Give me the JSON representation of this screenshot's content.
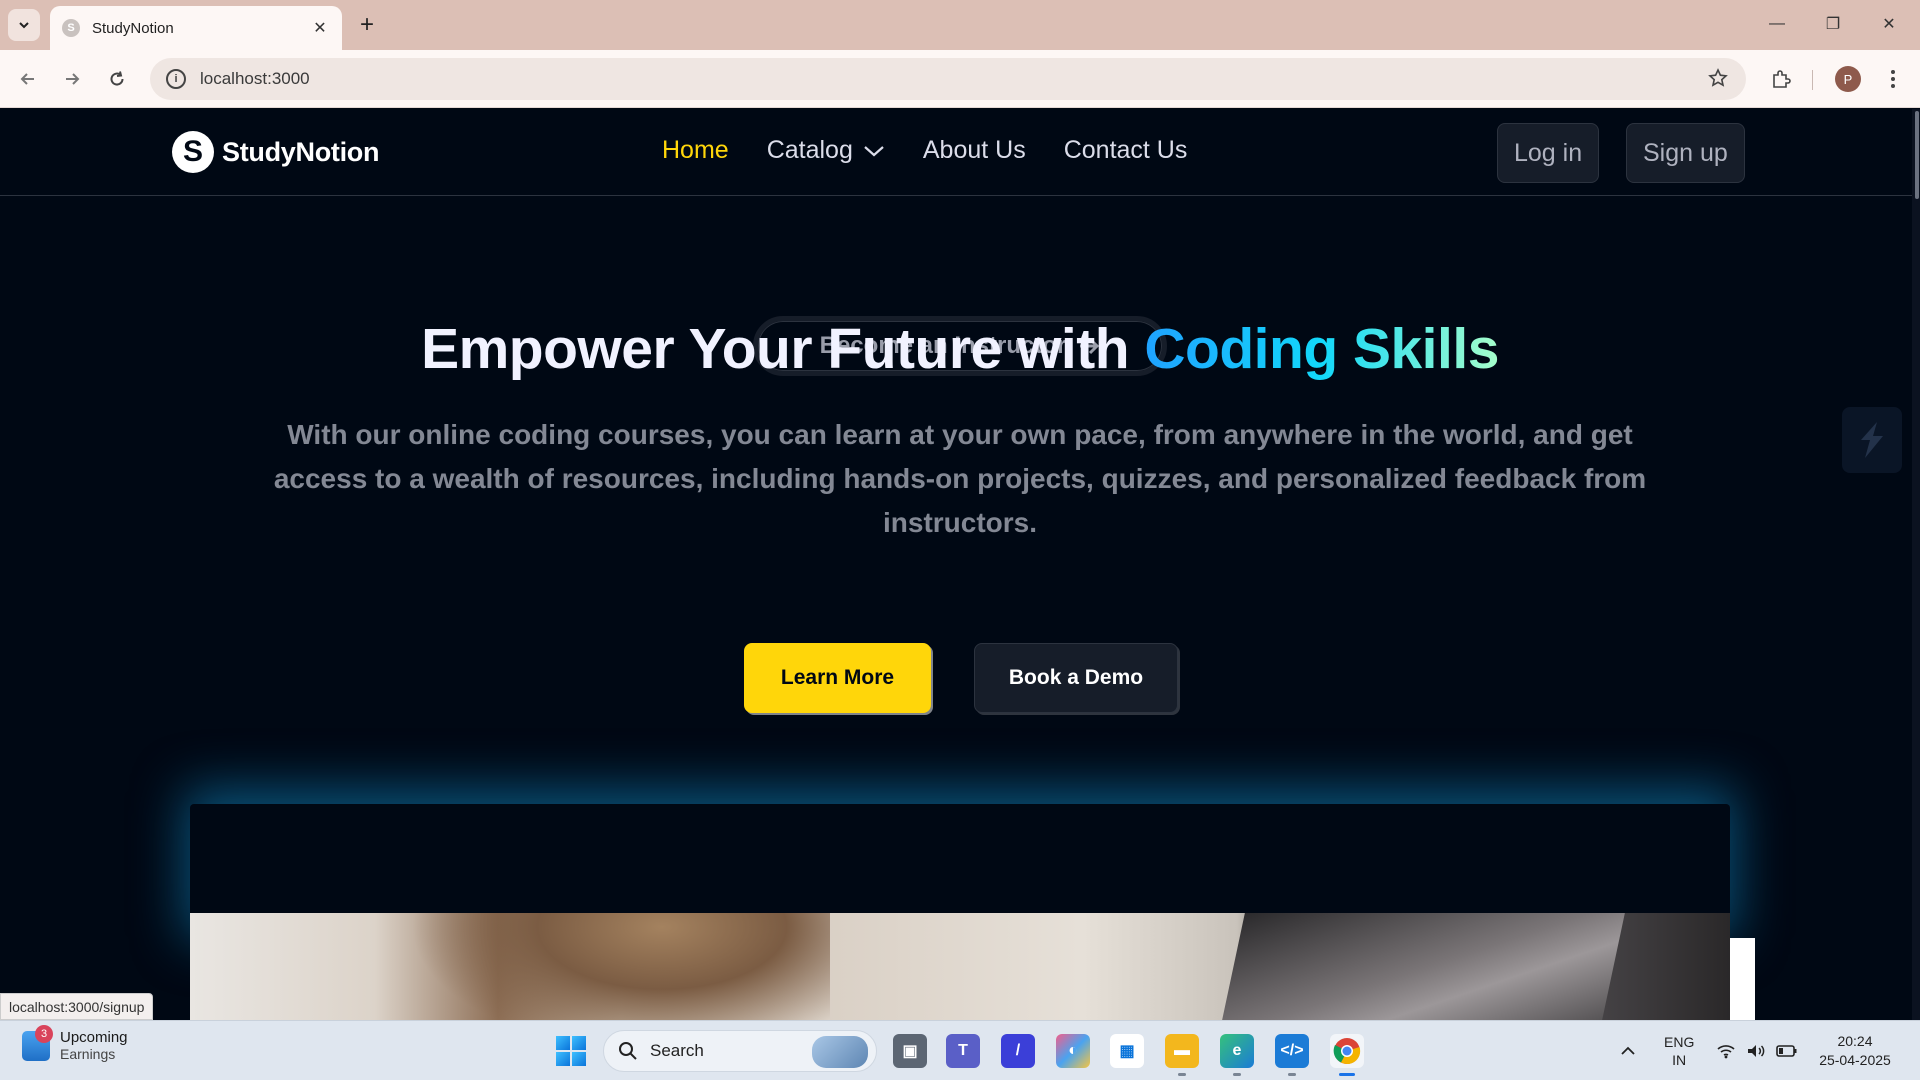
{
  "browser": {
    "tab_title": "StudyNotion",
    "tab_favicon_letter": "S",
    "url": "localhost:3000",
    "profile_initial": "P",
    "status_url": "localhost:3000/signup"
  },
  "navbar": {
    "logo_letter": "S",
    "logo_text": "StudyNotion",
    "links": [
      {
        "label": "Home",
        "active": true
      },
      {
        "label": "Catalog",
        "dropdown": true
      },
      {
        "label": "About Us"
      },
      {
        "label": "Contact Us"
      }
    ],
    "login_label": "Log in",
    "signup_label": "Sign up"
  },
  "hero": {
    "instructor_label": "Become an Instructor",
    "headline_prefix": "Empower Your Future with",
    "headline_highlight": "Coding Skills",
    "subtext": "With our online coding courses, you can learn at your own pace, from anywhere in the world, and get access to a wealth of resources, including hands-on projects, quizzes, and personalized feedback from instructors.",
    "learn_more_label": "Learn More",
    "book_demo_label": "Book a Demo"
  },
  "taskbar": {
    "widget_badge": "3",
    "widget_title": "Upcoming",
    "widget_subtitle": "Earnings",
    "search_label": "Search",
    "lang_line1": "ENG",
    "lang_line2": "IN",
    "time": "20:24",
    "date": "25-04-2025"
  },
  "colors": {
    "page_bg": "#000814",
    "accent_yellow": "#FFD60A",
    "gradient": [
      "#1FA2FF",
      "#12D8FA",
      "#A6FFCB"
    ]
  }
}
